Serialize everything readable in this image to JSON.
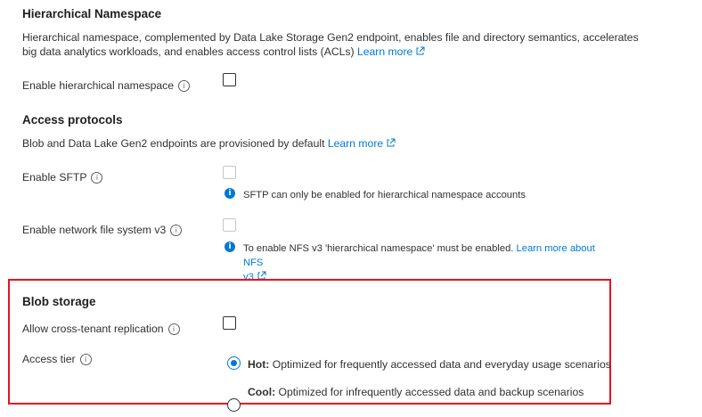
{
  "hns": {
    "title": "Hierarchical Namespace",
    "description_line1": "Hierarchical namespace, complemented by Data Lake Storage Gen2 endpoint, enables file and directory semantics, accelerates",
    "description_line2": "big data analytics workloads, and enables access control lists (ACLs)",
    "learn_more": "Learn more",
    "enable_label": "Enable hierarchical namespace"
  },
  "protocols": {
    "title": "Access protocols",
    "description": "Blob and Data Lake Gen2 endpoints are provisioned by default",
    "learn_more": "Learn more",
    "sftp_label": "Enable SFTP",
    "sftp_note": "SFTP can only be enabled for hierarchical namespace accounts",
    "nfs_label": "Enable network file system v3",
    "nfs_note": "To enable NFS v3 'hierarchical namespace' must be enabled.",
    "nfs_learn_more_part1": "Learn more about NFS",
    "nfs_learn_more_part2": "v3"
  },
  "blob": {
    "title": "Blob storage",
    "cross_tenant_label": "Allow cross-tenant replication",
    "access_tier_label": "Access tier",
    "tier_options": [
      {
        "name": "Hot:",
        "desc": "Optimized for frequently accessed data and everyday usage scenarios",
        "selected": true
      },
      {
        "name": "Cool:",
        "desc": "Optimized for infrequently accessed data and backup scenarios",
        "selected": false
      }
    ]
  },
  "icons": {
    "info": "i",
    "note": "i"
  },
  "colors": {
    "link": "#0078d4",
    "highlight_border": "#e81123"
  }
}
